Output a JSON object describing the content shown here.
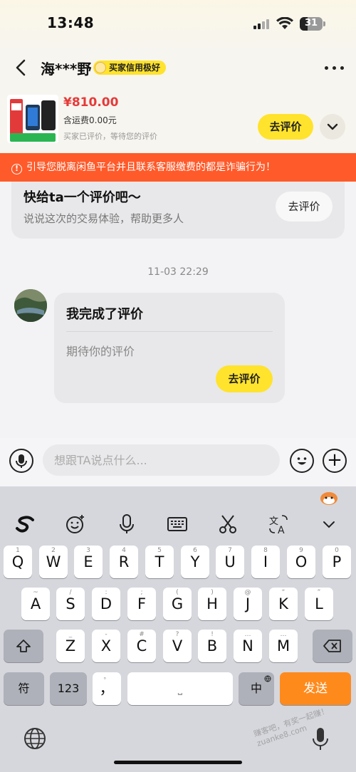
{
  "status_bar": {
    "time": "13:48",
    "battery": "31"
  },
  "header": {
    "seller_name": "海***野",
    "credit_badge": "买家信用极好"
  },
  "product": {
    "price": "¥810.00",
    "shipping": "含运费0.00元",
    "status": "买家已评价，等待您的评价",
    "review_button": "去评价"
  },
  "warning": {
    "icon": "!",
    "text": "引导您脱离闲鱼平台并且联系客服缴费的都是诈骗行为！"
  },
  "eval_card": {
    "title": "快给ta一个评价吧～",
    "subtitle": "说说这次的交易体验，帮助更多人",
    "button": "去评价"
  },
  "timestamp": "11-03 22:29",
  "message": {
    "title": "我完成了评价",
    "body": "期待你的评价",
    "button": "去评价"
  },
  "input": {
    "placeholder": "想跟TA说点什么..."
  },
  "keyboard": {
    "toolbar": [
      "sogou-logo-icon",
      "emoji-icon",
      "mic-icon",
      "keyboard-icon",
      "scissors-icon",
      "translate-icon",
      "chevron-down-icon"
    ],
    "row1": [
      [
        "Q",
        "1"
      ],
      [
        "W",
        "2"
      ],
      [
        "E",
        "3"
      ],
      [
        "R",
        "4"
      ],
      [
        "T",
        "5"
      ],
      [
        "Y",
        "6"
      ],
      [
        "U",
        "7"
      ],
      [
        "I",
        "8"
      ],
      [
        "O",
        "9"
      ],
      [
        "P",
        "0"
      ]
    ],
    "row2": [
      [
        "A",
        "~"
      ],
      [
        "S",
        "/"
      ],
      [
        "D",
        ":"
      ],
      [
        "F",
        ";"
      ],
      [
        "G",
        "("
      ],
      [
        "H",
        ")"
      ],
      [
        "J",
        "@"
      ],
      [
        "K",
        "“"
      ],
      [
        "L",
        "”"
      ]
    ],
    "row3": [
      [
        "Z",
        "_"
      ],
      [
        "X",
        "-"
      ],
      [
        "C",
        "#"
      ],
      [
        "V",
        "?"
      ],
      [
        "B",
        "!"
      ],
      [
        "N",
        "…"
      ],
      [
        "M",
        "…"
      ]
    ],
    "symbol_key": "符",
    "num_key": "123",
    "comma_key": "，",
    "comma_hint": "。",
    "space_key": "⎵",
    "lang_key": "中",
    "send_key": "发送"
  },
  "watermark": "赚客吧，有奖一起赚！ zuanke8.com"
}
